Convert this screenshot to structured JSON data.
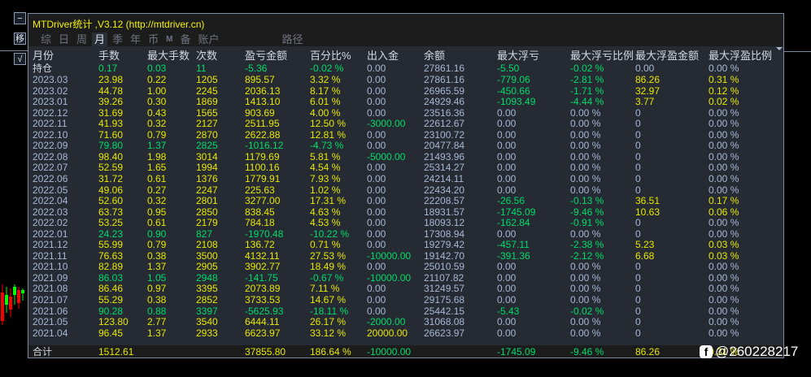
{
  "sidebar": {
    "collapse": "−",
    "move": "移",
    "check": "√"
  },
  "title": "MTDriver统计 ,V3.12 (http://mtdriver.cn)",
  "tabs": [
    {
      "label": "综",
      "active": false
    },
    {
      "label": "日",
      "active": false
    },
    {
      "label": "周",
      "active": false
    },
    {
      "label": "月",
      "active": true
    },
    {
      "label": "季",
      "active": false
    },
    {
      "label": "年",
      "active": false
    },
    {
      "label": "币",
      "active": false
    },
    {
      "label": "M",
      "active": false
    },
    {
      "label": "备",
      "active": false
    },
    {
      "label": "账户",
      "active": false
    },
    {
      "label": "路径",
      "active": false
    }
  ],
  "columns": [
    "月份",
    "手数",
    "最大手数",
    "次数",
    "盈亏金额",
    "百分比%",
    "出入金",
    "余额",
    "最大浮亏",
    "最大浮亏比例",
    "最大浮盈金额",
    "最大浮盈比例"
  ],
  "open_row": [
    "持仓",
    "0.17",
    "0.03",
    "11",
    "-5.36",
    "-0.02 %",
    "0.00",
    "27861.16",
    "-5.50",
    "-0.02 %",
    "0.00",
    "0.00 %"
  ],
  "rows": [
    [
      "2023.03",
      "23.98",
      "0.22",
      "1205",
      "895.57",
      "3.32 %",
      "0.00",
      "27861.16",
      "-779.06",
      "-2.81 %",
      "86.26",
      "0.31 %"
    ],
    [
      "2023.02",
      "44.78",
      "1.00",
      "2245",
      "2036.13",
      "8.17 %",
      "0.00",
      "26965.59",
      "-450.66",
      "-1.71 %",
      "32.97",
      "0.12 %"
    ],
    [
      "2023.01",
      "39.26",
      "0.30",
      "1869",
      "1413.10",
      "6.01 %",
      "0.00",
      "24929.46",
      "-1093.49",
      "-4.44 %",
      "3.77",
      "0.02 %"
    ],
    [
      "2022.12",
      "31.69",
      "0.43",
      "1565",
      "903.69",
      "4.00 %",
      "0.00",
      "23516.36",
      "0.00",
      "0.00 %",
      "0",
      "0.00 %"
    ],
    [
      "2022.11",
      "41.93",
      "0.32",
      "2127",
      "2511.95",
      "12.50 %",
      "-3000.00",
      "22612.67",
      "0.00",
      "0.00 %",
      "0",
      "0.00 %"
    ],
    [
      "2022.10",
      "71.60",
      "0.79",
      "2870",
      "2622.88",
      "12.81 %",
      "0.00",
      "23100.72",
      "0.00",
      "0.00 %",
      "0",
      "0.00 %"
    ],
    [
      "2022.09",
      "79.80",
      "1.37",
      "2825",
      "-1016.12",
      "-4.73 %",
      "0.00",
      "20477.84",
      "0.00",
      "0.00 %",
      "0",
      "0.00 %"
    ],
    [
      "2022.08",
      "98.40",
      "1.98",
      "3014",
      "1179.69",
      "5.81 %",
      "-5000.00",
      "21493.96",
      "0.00",
      "0.00 %",
      "0",
      "0.00 %"
    ],
    [
      "2022.07",
      "52.59",
      "1.65",
      "1994",
      "1100.16",
      "4.54 %",
      "0.00",
      "25314.27",
      "0.00",
      "0.00 %",
      "0",
      "0.00 %"
    ],
    [
      "2022.06",
      "31.72",
      "0.61",
      "1376",
      "1779.91",
      "7.93 %",
      "0.00",
      "24214.11",
      "0.00",
      "0.00 %",
      "0",
      "0.00 %"
    ],
    [
      "2022.05",
      "49.06",
      "0.27",
      "2247",
      "225.63",
      "1.02 %",
      "0.00",
      "22434.20",
      "0.00",
      "0.00 %",
      "0",
      "0.00 %"
    ],
    [
      "2022.04",
      "52.60",
      "0.32",
      "2801",
      "3277.00",
      "17.31 %",
      "0.00",
      "22208.57",
      "-26.56",
      "-0.13 %",
      "36.51",
      "0.17 %"
    ],
    [
      "2022.03",
      "63.73",
      "0.95",
      "2850",
      "838.45",
      "4.63 %",
      "0.00",
      "18931.57",
      "-1745.09",
      "-9.46 %",
      "10.63",
      "0.06 %"
    ],
    [
      "2022.02",
      "53.25",
      "0.61",
      "2179",
      "784.18",
      "4.53 %",
      "0.00",
      "18093.12",
      "-162.84",
      "-0.91 %",
      "0",
      "0.00 %"
    ],
    [
      "2022.01",
      "24.23",
      "0.90",
      "827",
      "-1970.48",
      "-10.22 %",
      "0.00",
      "17308.94",
      "0.00",
      "0.00 %",
      "0",
      "0.00 %"
    ],
    [
      "2021.12",
      "55.99",
      "0.79",
      "2108",
      "136.72",
      "0.71 %",
      "0.00",
      "19279.42",
      "-457.11",
      "-2.38 %",
      "5.23",
      "0.03 %"
    ],
    [
      "2021.11",
      "76.63",
      "0.38",
      "3500",
      "4132.11",
      "27.53 %",
      "-10000.00",
      "19142.70",
      "-391.36",
      "-2.12 %",
      "6.68",
      "0.03 %"
    ],
    [
      "2021.10",
      "82.89",
      "1.37",
      "2905",
      "3902.77",
      "18.49 %",
      "0.00",
      "25010.59",
      "0.00",
      "0.00 %",
      "0",
      "0.00 %"
    ],
    [
      "2021.09",
      "86.03",
      "1.05",
      "2948",
      "-141.75",
      "-0.67 %",
      "-10000.00",
      "21107.82",
      "0.00",
      "0.00 %",
      "0",
      "0.00 %"
    ],
    [
      "2021.08",
      "86.46",
      "0.97",
      "3395",
      "2073.89",
      "7.11 %",
      "0.00",
      "31249.57",
      "0.00",
      "0.00 %",
      "0",
      "0.00 %"
    ],
    [
      "2021.07",
      "55.29",
      "0.38",
      "2852",
      "3733.53",
      "14.67 %",
      "0.00",
      "29175.68",
      "0.00",
      "0.00 %",
      "0",
      "0.00 %"
    ],
    [
      "2021.06",
      "90.28",
      "0.88",
      "3397",
      "-5625.93",
      "-18.11 %",
      "0.00",
      "25442.15",
      "-5.43",
      "-0.02 %",
      "0",
      "0.00 %"
    ],
    [
      "2021.05",
      "123.80",
      "2.77",
      "3540",
      "6444.11",
      "26.17 %",
      "-2000.00",
      "31068.08",
      "0.00",
      "0.00 %",
      "0",
      "0.00 %"
    ],
    [
      "2021.04",
      "96.45",
      "1.37",
      "2933",
      "6623.97",
      "33.12 %",
      "20000.00",
      "26623.97",
      "0.00",
      "0.00 %",
      "0",
      "0.00 %"
    ]
  ],
  "total_row": [
    "合计",
    "1512.61",
    "",
    "",
    "37855.80",
    "186.64 %",
    "-10000.00",
    "",
    "-1745.09",
    "-9.46 %",
    "86.26",
    "0.31 %"
  ],
  "watermark": "@260228217",
  "colors": {
    "positive": "#e8e800",
    "negative": "#00dc6a",
    "neutral": "#a9b8d6",
    "panel": "#252a33"
  }
}
